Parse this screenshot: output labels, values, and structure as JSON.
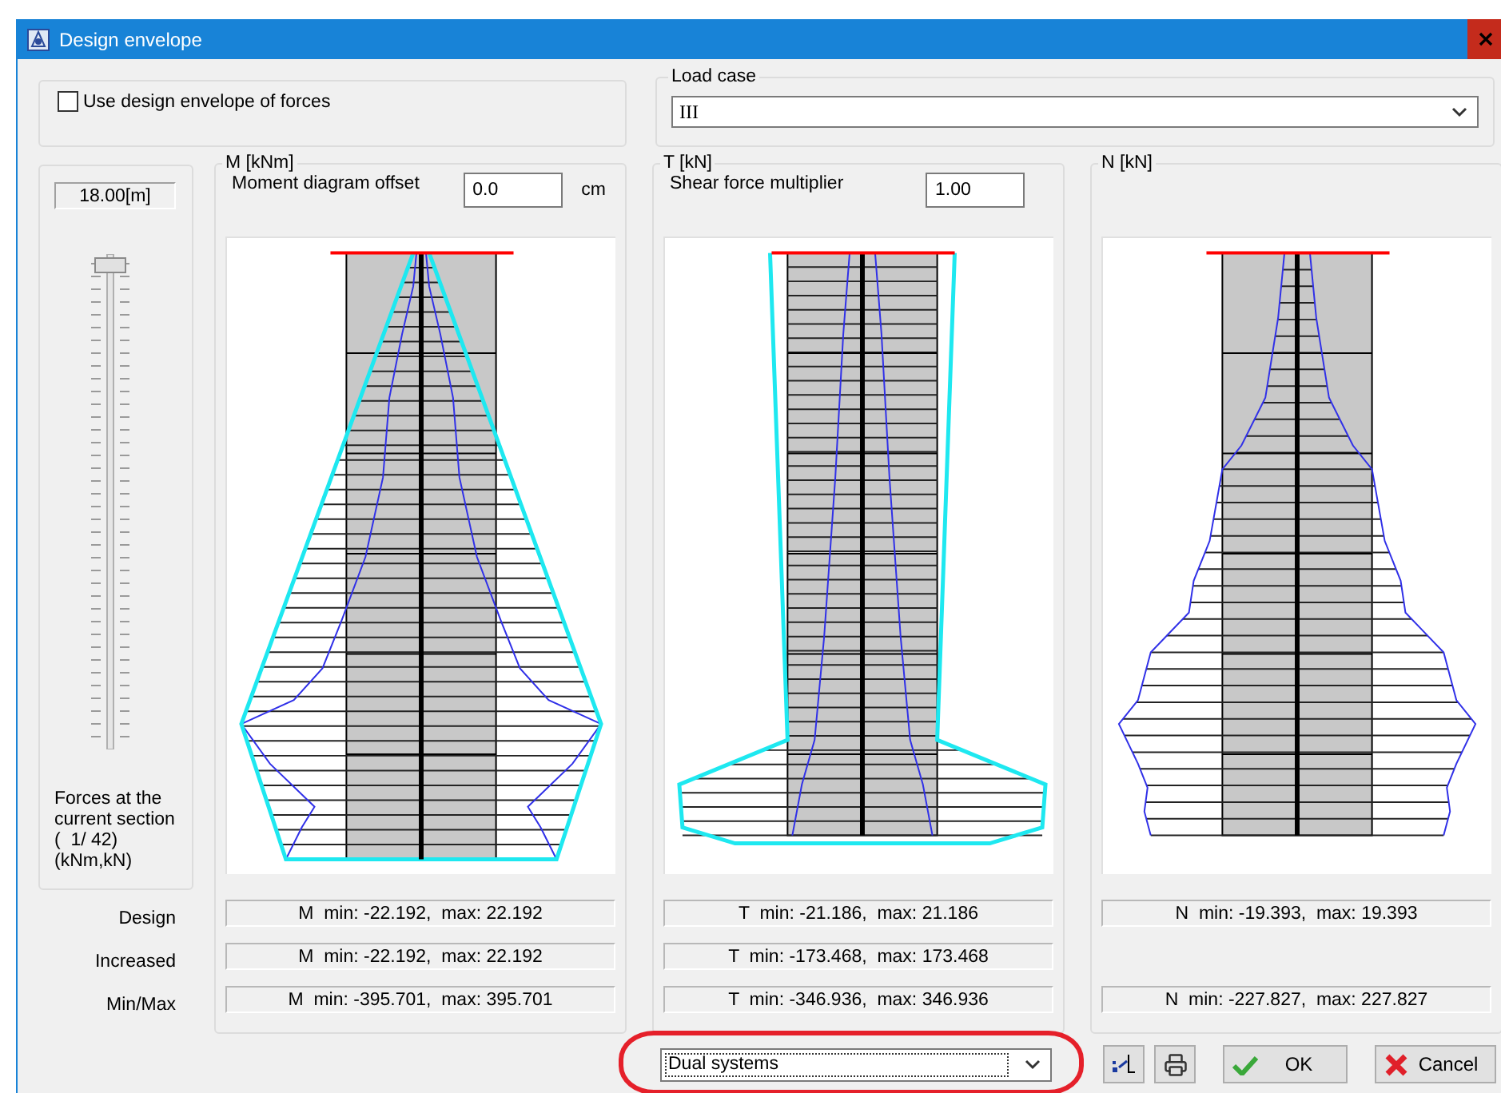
{
  "window": {
    "title": "Design envelope"
  },
  "design_envelope_checkbox": {
    "label": "Use design envelope of forces",
    "checked": false
  },
  "load_case": {
    "label": "Load case",
    "value": "III"
  },
  "section_panel": {
    "position": "18.00[m]",
    "slider": {
      "level": 0
    },
    "caption_lines": [
      "Forces at the",
      "current section",
      "(  1/ 42)",
      "(kNm,kN)"
    ]
  },
  "row_labels": [
    "Design",
    "Increased",
    "Min/Max"
  ],
  "diagrams": [
    {
      "title": "M [kNm]",
      "kind": "moment",
      "option": {
        "label": "Moment diagram offset",
        "value": "0.0",
        "unit": "cm"
      },
      "results": {
        "design": "M  min: -22.192,  max: 22.192",
        "increased": "M  min: -22.192,  max: 22.192",
        "min_max": "M  min: -395.701,  max: 395.701"
      }
    },
    {
      "title": "T [kN]",
      "kind": "shear",
      "option": {
        "label": "Shear force multiplier",
        "value": "1.00"
      },
      "results": {
        "design": "T  min: -21.186,  max: 21.186",
        "increased": "T  min: -173.468,  max: 173.468",
        "min_max": "T  min: -346.936,  max: 346.936"
      }
    },
    {
      "title": "N [kN]",
      "kind": "axial",
      "results": {
        "design": "N  min: -19.393,  max: 19.393",
        "min_max": "N  min: -227.827,  max: 227.827"
      }
    }
  ],
  "system_dropdown": {
    "value": "Dual systems"
  },
  "buttons": [
    {
      "kind": "diagram"
    },
    {
      "kind": "print"
    },
    {
      "kind": "ok",
      "label": "OK"
    },
    {
      "kind": "cancel",
      "label": "Cancel"
    }
  ]
}
